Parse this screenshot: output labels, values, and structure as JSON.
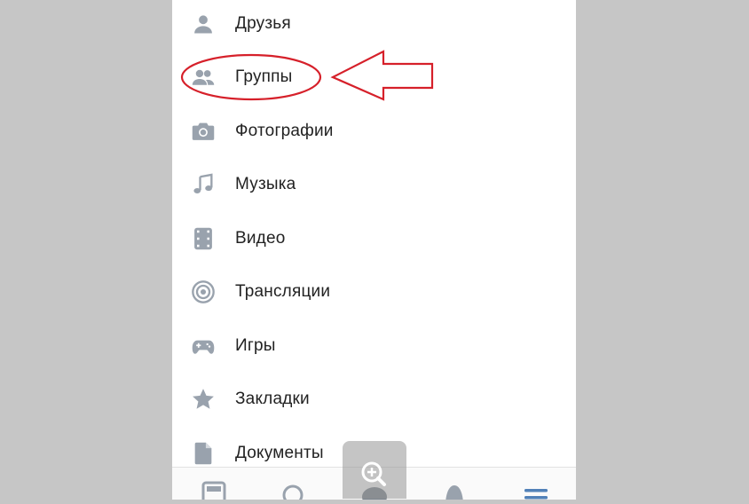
{
  "menu": {
    "items": [
      {
        "label": "Друзья",
        "icon": "person-icon"
      },
      {
        "label": "Группы",
        "icon": "group-icon"
      },
      {
        "label": "Фотографии",
        "icon": "camera-icon"
      },
      {
        "label": "Музыка",
        "icon": "music-note-icon"
      },
      {
        "label": "Видео",
        "icon": "video-icon"
      },
      {
        "label": "Трансляции",
        "icon": "broadcast-icon"
      },
      {
        "label": "Игры",
        "icon": "gamepad-icon"
      },
      {
        "label": "Закладки",
        "icon": "star-icon"
      },
      {
        "label": "Документы",
        "icon": "document-icon"
      }
    ]
  },
  "bottom_nav": {
    "tabs": [
      "news-icon",
      "search-icon",
      "messages-icon",
      "notifications-icon",
      "menu-icon"
    ],
    "active_tab": "menu-icon"
  },
  "colors": {
    "icon_gray": "#99a2ad",
    "active_blue": "#5181b8",
    "annotation_red": "#d6202a",
    "side_background": "#c6c6c6"
  }
}
